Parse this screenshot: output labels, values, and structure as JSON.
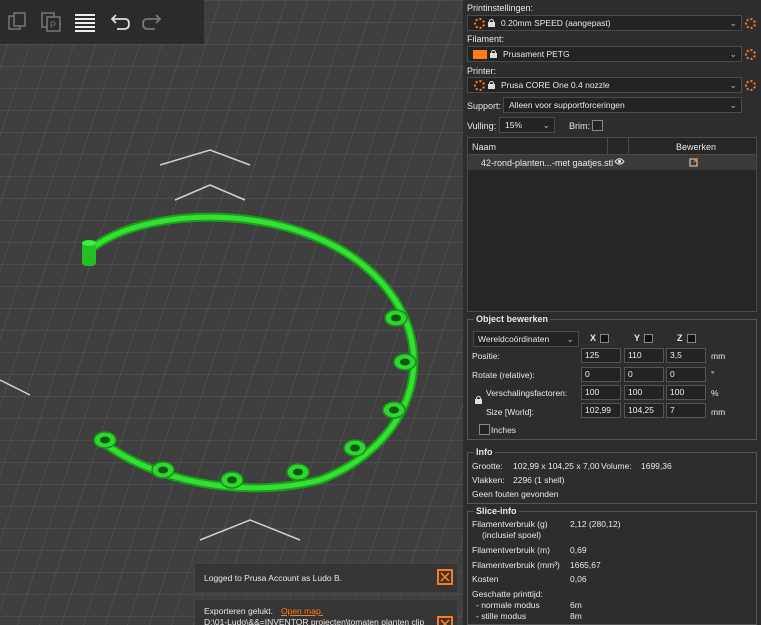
{
  "toolbar": {
    "icons": [
      "copy-icon",
      "paste-icon",
      "layers-icon",
      "undo-icon",
      "redo-icon"
    ]
  },
  "notifications": {
    "login": "Logged to Prusa Account as Ludo B.",
    "export_status": "Exporteren gelukt.",
    "export_link": "Open map.",
    "export_path": "D:\\01-Ludo\\&&=INVENTOR projecten\\tomaten planten clip"
  },
  "settings": {
    "print_label": "Printinstellingen:",
    "print_value": "0.20mm SPEED (aangepast)",
    "filament_label": "Filament:",
    "filament_value": "Prusament PETG",
    "filament_color": "#ff7a1a",
    "printer_label": "Printer:",
    "printer_value": "Prusa CORE One 0.4 nozzle",
    "support_label": "Support:",
    "support_value": "Alleen voor supportforceringen",
    "infill_label": "Vulling:",
    "infill_value": "15%",
    "brim_label": "Brim:"
  },
  "object_list": {
    "col_name": "Naam",
    "col_edit": "Bewerken",
    "items": [
      {
        "name": "42-rond-planten...-met gaatjes.stl"
      }
    ]
  },
  "object_edit": {
    "title": "Object bewerken",
    "coord_mode": "Wereldcoördinaten",
    "axes": [
      "X",
      "Y",
      "Z"
    ],
    "position_label": "Positie:",
    "position": [
      "125",
      "110",
      "3,5"
    ],
    "position_unit": "mm",
    "rotate_label": "Rotate (relative):",
    "rotate": [
      "0",
      "0",
      "0"
    ],
    "rotate_unit": "°",
    "scale_label": "Verschalingsfactoren:",
    "scale": [
      "100",
      "100",
      "100"
    ],
    "scale_unit": "%",
    "size_label": "Size [World]:",
    "size": [
      "102,99",
      "104,25",
      "7"
    ],
    "size_unit": "mm",
    "inches_label": "Inches"
  },
  "info": {
    "title": "Info",
    "size_label": "Grootte:",
    "size_value": "102,99 x 104,25 x 7,00",
    "volume_label": "Volume:",
    "volume_value": "1699,36",
    "facets_label": "Vlakken:",
    "facets_value": "2296 (1 shell)",
    "errors": "Geen fouten gevonden"
  },
  "slice_info": {
    "title": "Slice-info",
    "rows": [
      {
        "label": "Filamentverbruik (g)",
        "value": "2,12 (280,12)"
      },
      {
        "label": "(inclusief spoel)",
        "value": ""
      },
      {
        "label": "Filamentverbruik (m)",
        "value": "0,69"
      },
      {
        "label": "Filamentverbruik (mm³)",
        "value": "1665,67"
      },
      {
        "label": "Kosten",
        "value": "0,06"
      },
      {
        "label": "Geschatte printtijd:",
        "value": ""
      },
      {
        "label": "- normale modus",
        "value": "6m"
      },
      {
        "label": "- stille modus",
        "value": "8m"
      }
    ]
  }
}
